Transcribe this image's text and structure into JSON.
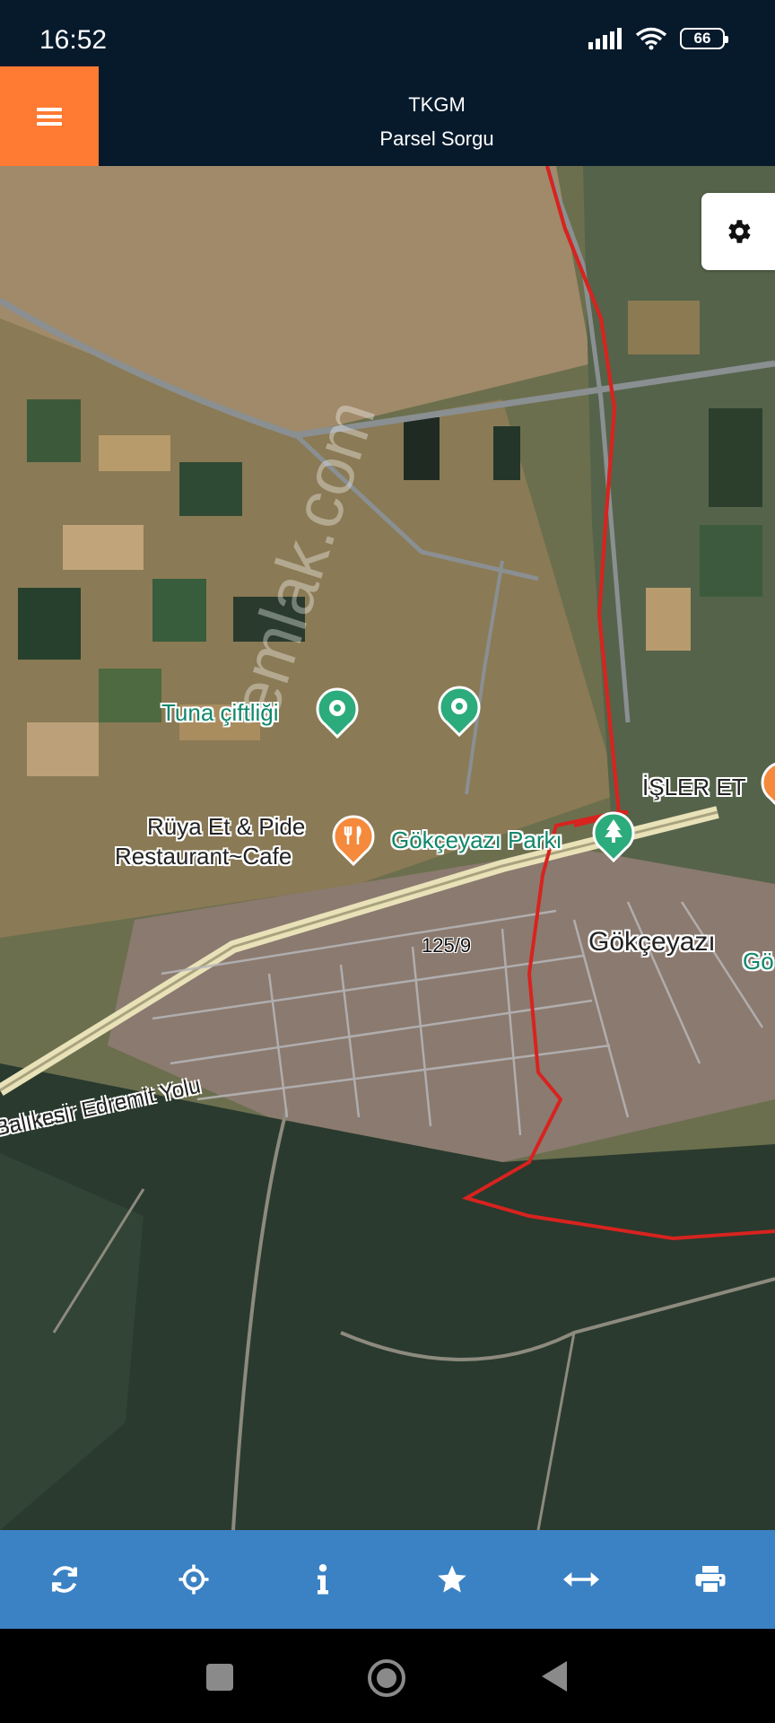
{
  "status": {
    "time": "16:52",
    "battery": "66"
  },
  "header": {
    "title": "TKGM",
    "subtitle": "Parsel Sorgu",
    "menu_icon": "hamburger-menu-icon"
  },
  "map": {
    "settings_icon": "gear-icon",
    "labels": {
      "tuna": "Tuna çiftliği",
      "ruya_line1": "Rüya Et & Pide",
      "ruya_line2": "Restaurant~Cafe",
      "park": "Gökçeyazı Parkı",
      "isler": "İŞLER ET",
      "gokceyazi": "Gökçeyazı",
      "gokceyazi_partial": "Gö",
      "road": "Balıkesir Edremit Yolu",
      "parcel": "125/9"
    },
    "boundary_color": "#d8231f",
    "pin_colors": {
      "park": "#2cab7c",
      "food": "#f58a3c"
    }
  },
  "toolbar": {
    "items": [
      {
        "name": "refresh-button",
        "icon": "refresh-icon"
      },
      {
        "name": "locate-button",
        "icon": "crosshair-icon"
      },
      {
        "name": "info-button",
        "icon": "info-icon"
      },
      {
        "name": "favorite-button",
        "icon": "star-icon"
      },
      {
        "name": "measure-button",
        "icon": "arrows-horizontal-icon"
      },
      {
        "name": "print-button",
        "icon": "printer-icon"
      }
    ]
  },
  "colors": {
    "header_bg": "#071a2c",
    "accent": "#ff7a33",
    "toolbar_bg": "#3b82c4"
  }
}
